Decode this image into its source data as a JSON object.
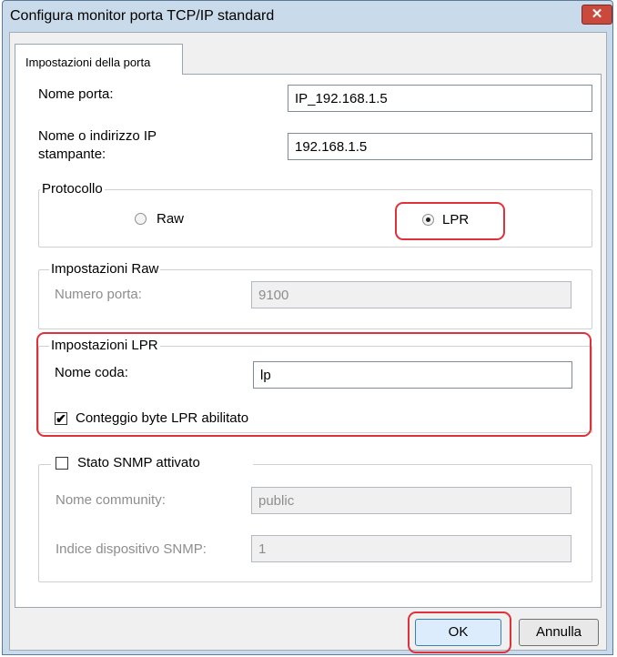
{
  "window": {
    "title": "Configura monitor porta TCP/IP standard",
    "close_glyph": "✕"
  },
  "tab": {
    "label": "Impostazioni della porta"
  },
  "port_name": {
    "label": "Nome porta:",
    "value": "IP_192.168.1.5"
  },
  "printer_address": {
    "label_line1": "Nome o indirizzo IP",
    "label_line2": "stampante:",
    "value": "192.168.1.5"
  },
  "protocol": {
    "legend": "Protocollo",
    "options": [
      {
        "label": "Raw",
        "selected": false
      },
      {
        "label": "LPR",
        "selected": true
      }
    ]
  },
  "raw_settings": {
    "legend": "Impostazioni Raw",
    "port_number_label": "Numero porta:",
    "port_number_value": "9100"
  },
  "lpr_settings": {
    "legend": "Impostazioni LPR",
    "queue_name_label": "Nome coda:",
    "queue_name_value": "lp",
    "byte_count_label": "Conteggio byte LPR abilitato",
    "byte_count_checked": true,
    "check_glyph": "✔"
  },
  "snmp": {
    "legend": "Stato SNMP attivato",
    "checked": false,
    "community_label": "Nome community:",
    "community_value": "public",
    "device_index_label": "Indice dispositivo SNMP:",
    "device_index_value": "1"
  },
  "buttons": {
    "ok": "OK",
    "cancel": "Annulla"
  },
  "colors": {
    "highlight": "#e0303a",
    "titlebar": "#c9daea",
    "close_button": "#c94a3d"
  }
}
